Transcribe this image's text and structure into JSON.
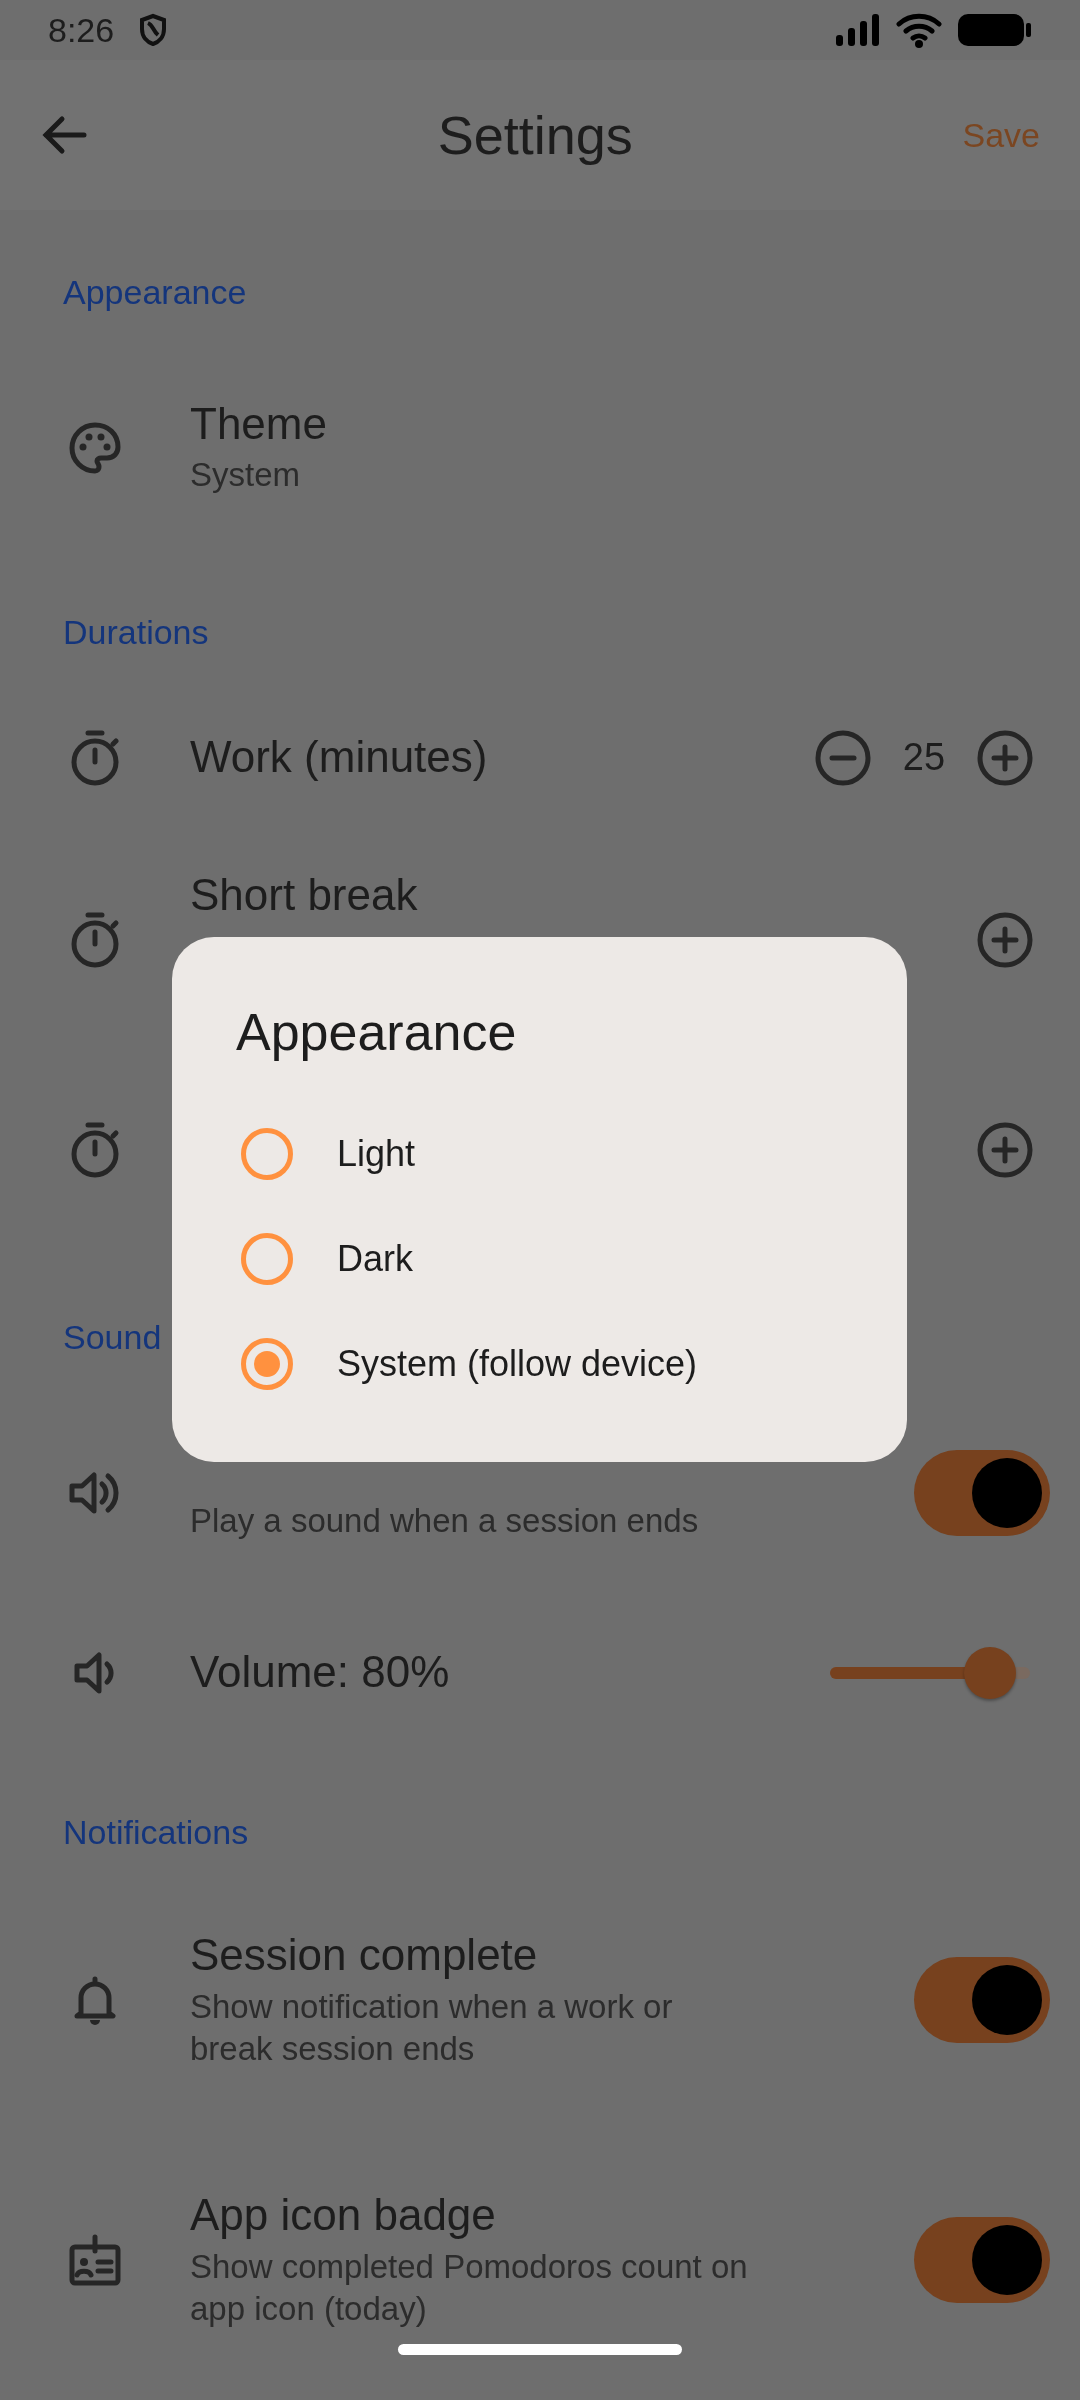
{
  "status_bar": {
    "time": "8:26"
  },
  "app_bar": {
    "title": "Settings",
    "action": "Save"
  },
  "sections": [
    {
      "title": "Appearance",
      "items": [
        {
          "kind": "value",
          "title": "Theme",
          "subtitle": "System"
        }
      ]
    },
    {
      "title": "Durations",
      "items": [
        {
          "kind": "stepper",
          "title": "Work (minutes)",
          "value": "25"
        },
        {
          "kind": "stepper",
          "title": "Short break"
        },
        {
          "kind": "stepper"
        }
      ]
    },
    {
      "title": "Sound",
      "items": [
        {
          "kind": "switch",
          "subtitle": "Play a sound when a session ends",
          "on": true
        },
        {
          "kind": "slider",
          "title": "Volume: 80%",
          "level": 0.8
        }
      ]
    },
    {
      "title": "Notifications",
      "items": [
        {
          "kind": "switch",
          "title": "Session complete",
          "subtitle": "Show notification when a work or break session ends",
          "on": true
        },
        {
          "kind": "switch",
          "title": "App icon badge",
          "subtitle": "Show completed Pomodoros count on app icon (today)",
          "on": true
        }
      ]
    }
  ],
  "dialog": {
    "title": "Appearance",
    "options": [
      {
        "label": "Light",
        "selected": false
      },
      {
        "label": "Dark",
        "selected": false
      },
      {
        "label": "System (follow device)",
        "selected": true
      }
    ]
  }
}
